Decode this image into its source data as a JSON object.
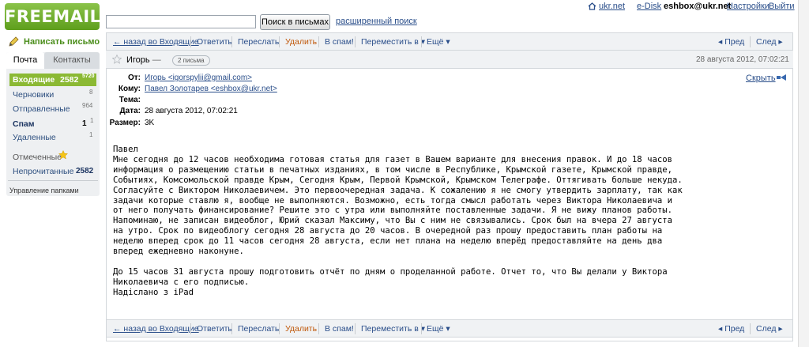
{
  "header": {
    "logo": "FREEMAIL",
    "search_placeholder": "",
    "search_button": "Поиск в письмах",
    "advanced_search": "расширенный поиск",
    "top_links": {
      "ukr": "ukr.net",
      "edisk": "e-Disk",
      "user": "eshbox@ukr.net",
      "settings": "Настройки",
      "logout": "Выйти"
    }
  },
  "sidebar": {
    "compose": "Написать письмо",
    "tabs": {
      "mail": "Почта",
      "contacts": "Контакты"
    },
    "folders": {
      "inbox": {
        "label": "Входящие",
        "count": "2582",
        "sup": "5720"
      },
      "drafts": {
        "label": "Черновики",
        "count": "8"
      },
      "sent": {
        "label": "Отправленные",
        "count": "964"
      },
      "spam": {
        "label": "Спам",
        "count": "1",
        "sup": "1"
      },
      "deleted": {
        "label": "Удаленные",
        "count": "1"
      },
      "starred": {
        "label": "Отмеченные"
      },
      "unread": {
        "label": "Непрочитанные",
        "count": "2582"
      }
    },
    "manage": "Управление папками"
  },
  "toolbar": {
    "back": "← назад во Входящие",
    "reply": "Ответить",
    "forward": "Переслать",
    "delete": "Удалить",
    "spam": "В спам!",
    "move": "Переместить в ▾",
    "more": "Ещё ▾",
    "prev": "◂ Пред",
    "next": "След ▸"
  },
  "message": {
    "sender_name": "Игорь",
    "dash": "—",
    "thread_count": "2 письма",
    "date_top": "28 августа 2012, 07:02:21",
    "hide": "Скрыть",
    "headers": {
      "from_label": "От:",
      "from": "Игорь <igorspylii@gmail.com>",
      "to_label": "Кому:",
      "to": "Павел Золотарев <eshbox@ukr.net>",
      "subject_label": "Тема:",
      "subject": "",
      "date_label": "Дата:",
      "date": "28 августа 2012, 07:02:21",
      "size_label": "Размер:",
      "size": "3K"
    },
    "body": "Павел\nМне сегодня до 12 часов необходима готовая статья для газет в Вашем варианте для внесения правок. И до 18 часов\nинформация о размещению статьи в печатных изданиях, в том числе в Республике, Крымской газете, Крымской правде,\nСобытиях, Комсомольской правде Крым, Сегодня Крым, Первой Крымской, Крымском Телеграфе. Оттягивать больше некуда.\nСогласуйте с Виктором Николаевичем. Это первоочередная задача. К сожалению я не смогу утвердить зарплату, так как\nзадачи которые ставлю я, вообще не выполняются. Возможно, есть тогда смысл работать через Виктора Николаевича и\nот него получать финансирование? Решите это с утра или выполняйте поставленные задачи. Я не вижу планов работы.\nНапоминаю, не записан видеоблог, Юрий сказал Максиму, что Вы с ним не связывались. Срок был на вчера 27 августа\nна утро. Срок по видеоблогу сегодня 28 августа до 20 часов. В очередной раз прошу предоставить план работы на\nнеделю вперед срок до 11 часов сегодня 28 августа, если нет плана на неделю вперёд предоставляйте на день два\nвперед ежедневно наконуне.\n\nДо 15 часов 31 августа прошу подготовить отчёт по дням о проделанной работе. Отчет то, что Вы делали у Виктора\nНиколаевича с его подписью.\nНадіслано з iPad"
  },
  "colors": {
    "brand_green": "#6aad28",
    "link_blue": "#2a4e8a",
    "delete_orange": "#c0580a",
    "inbox_bg": "#8bb934"
  }
}
